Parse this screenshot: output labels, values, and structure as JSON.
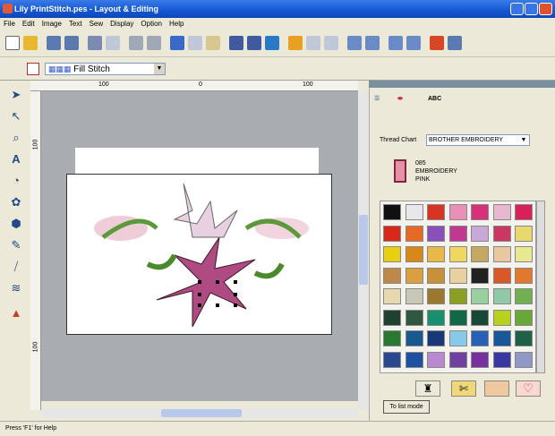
{
  "window": {
    "title": "Lily PrintStitch.pes - Layout & Editing"
  },
  "menu": [
    "File",
    "Edit",
    "Image",
    "Text",
    "Sew",
    "Display",
    "Option",
    "Help"
  ],
  "stitch": {
    "value": "Fill Stitch"
  },
  "ruler": {
    "top_labels": [
      "100",
      "0",
      "100"
    ],
    "left_labels": [
      "100",
      "100"
    ]
  },
  "panel": {
    "tab_text": "ABC",
    "thread_chart_label": "Thread Chart",
    "thread_chart_value": "BROTHER EMBROIDERY",
    "thread_code": "085",
    "thread_name_1": "EMBROIDERY",
    "thread_name_2": "PINK",
    "list_mode_label": "To list mode",
    "colors": [
      [
        "#101010",
        "#e8e8ec",
        "#d83424",
        "#e890b8",
        "#d8307a",
        "#e8b8d0",
        "#d8205a"
      ],
      [
        "#d82818",
        "#e86828",
        "#8850b8",
        "#c03890",
        "#c8a8d8",
        "#c83860",
        "#e8d870"
      ],
      [
        "#e8d010",
        "#d88818",
        "#e8b848",
        "#f0d860",
        "#c8a860",
        "#e8c8a0",
        "#e8e890"
      ],
      [
        "#c08848",
        "#d8a040",
        "#c89038",
        "#e8d0a0",
        "#202020",
        "#d85828",
        "#e07830"
      ],
      [
        "#e8d8b0",
        "#c8c8b8",
        "#9a7830",
        "#8aa020",
        "#98d0a0",
        "#90c8a8",
        "#70b050"
      ],
      [
        "#204030",
        "#305840",
        "#189070",
        "#106848",
        "#184838",
        "#b8d020",
        "#68a838"
      ],
      [
        "#287a30",
        "#1a5890",
        "#183878",
        "#88c8e8",
        "#2860b8",
        "#185898",
        "#206048"
      ],
      [
        "#284890",
        "#2050a0",
        "#b888d0",
        "#7040a0",
        "#7830a0",
        "#3838a0",
        "#9098c8"
      ]
    ]
  },
  "status": "Press 'F1' for Help"
}
